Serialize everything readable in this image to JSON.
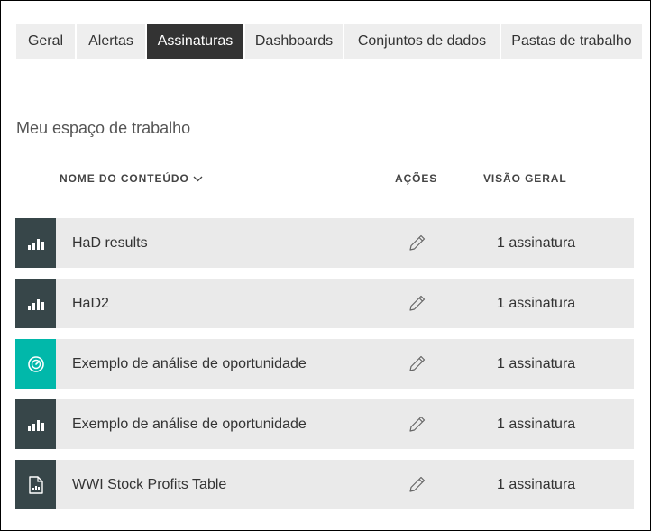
{
  "tabs": [
    {
      "label": "Geral",
      "active": false
    },
    {
      "label": "Alertas",
      "active": false
    },
    {
      "label": "Assinaturas",
      "active": true
    },
    {
      "label": "Dashboards",
      "active": false
    },
    {
      "label": "Conjuntos de dados",
      "active": false
    },
    {
      "label": "Pastas de trabalho",
      "active": false
    }
  ],
  "workspace": {
    "title": "Meu espaço de trabalho"
  },
  "columns": {
    "name": "NOME DO CONTEÚDO",
    "actions": "AÇÕES",
    "overview": "VISÃO GERAL"
  },
  "colors": {
    "report_icon_bg": "#374649",
    "dashboard_icon_bg": "#01B8AA",
    "active_tab_bg": "#333333",
    "row_bg": "#EAEAEA"
  },
  "rows": [
    {
      "name": "HaD results",
      "count": "1 assinatura",
      "icon": "bar-chart-icon"
    },
    {
      "name": "HaD2",
      "count": "1 assinatura",
      "icon": "bar-chart-icon"
    },
    {
      "name": "Exemplo de análise de oportunidade",
      "count": "1 assinatura",
      "icon": "gauge-icon"
    },
    {
      "name": "Exemplo de análise de oportunidade",
      "count": "1 assinatura",
      "icon": "bar-chart-icon"
    },
    {
      "name": "WWI Stock Profits Table",
      "count": "1 assinatura",
      "icon": "paginated-report-icon"
    }
  ]
}
